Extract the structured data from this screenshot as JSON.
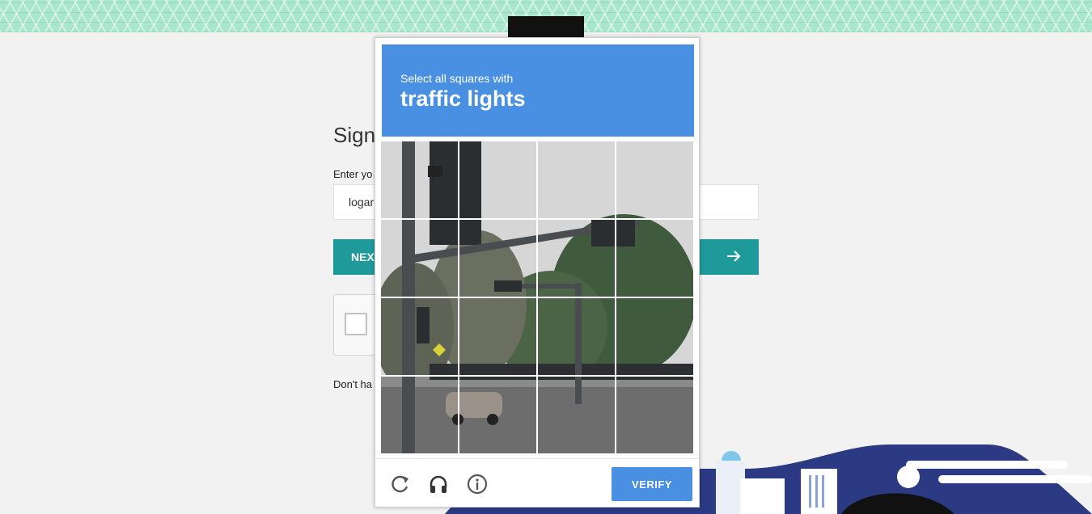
{
  "signin": {
    "title": "Sign",
    "field_label": "Enter yo",
    "username_value": "logar",
    "next_label": "NEX",
    "signup_text": "Don't ha"
  },
  "challenge": {
    "prompt_line": "Select all squares with",
    "prompt_target": "traffic lights",
    "verify_label": "VERIFY",
    "tiles": [
      {
        "label": ""
      },
      {
        "label": ""
      },
      {
        "label": ""
      },
      {
        "label": ""
      },
      {
        "label": ""
      },
      {
        "label": ""
      },
      {
        "label": ""
      },
      {
        "label": ""
      },
      {
        "label": ""
      },
      {
        "label": ""
      },
      {
        "label": ""
      },
      {
        "label": ""
      },
      {
        "label": ""
      },
      {
        "label": ""
      },
      {
        "label": ""
      },
      {
        "label": ""
      }
    ],
    "icons": [
      "reload-icon",
      "headphones-icon",
      "info-icon"
    ]
  },
  "colors": {
    "header_blue": "#4a90e2",
    "next_teal": "#1f9a9a",
    "city_navy": "#2b3a82",
    "band_green": "#a9e6cf"
  }
}
